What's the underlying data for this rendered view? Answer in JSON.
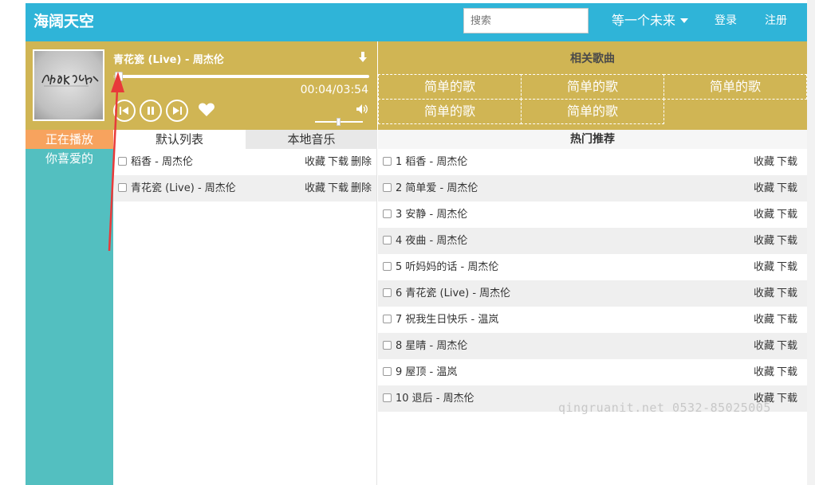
{
  "header": {
    "brand": "海阔天空",
    "search_placeholder": "搜索",
    "user_menu": "等一个未来",
    "login": "登录",
    "register": "注册"
  },
  "sidebar": {
    "items": [
      {
        "label": "正在播放",
        "active": true
      },
      {
        "label": "你喜爱的",
        "active": false
      }
    ]
  },
  "player": {
    "title": "青花瓷 (Live) - 周杰伦",
    "time": "00:04/03:54",
    "progress": 0.017,
    "volume": 0.5,
    "colors": {
      "panel": "#d0b554",
      "accent": "#f7a35e"
    }
  },
  "tabs": {
    "default": "默认列表",
    "local": "本地音乐"
  },
  "playlist": [
    {
      "name": "稻香 - 周杰伦",
      "actions": [
        "收藏",
        "下载",
        "删除"
      ]
    },
    {
      "name": "青花瓷 (Live) - 周杰伦",
      "actions": [
        "收藏",
        "下载",
        "删除"
      ]
    }
  ],
  "related": {
    "title": "相关歌曲",
    "songs": [
      "简单的歌",
      "简单的歌",
      "简单的歌",
      "简单的歌",
      "简单的歌"
    ]
  },
  "hot": {
    "title": "热门推荐",
    "actions": [
      "收藏",
      "下载"
    ],
    "songs": [
      "1 稻香 - 周杰伦",
      "2 简单爱 - 周杰伦",
      "3 安静 - 周杰伦",
      "4 夜曲 - 周杰伦",
      "5 听妈妈的话 - 周杰伦",
      "6 青花瓷 (Live) - 周杰伦",
      "7 祝我生日快乐 - 温岚",
      "8 星晴 - 周杰伦",
      "9 屋顶 - 温岚",
      "10 退后 - 周杰伦"
    ]
  },
  "watermark": "qingruanit.net 0532-85025005"
}
